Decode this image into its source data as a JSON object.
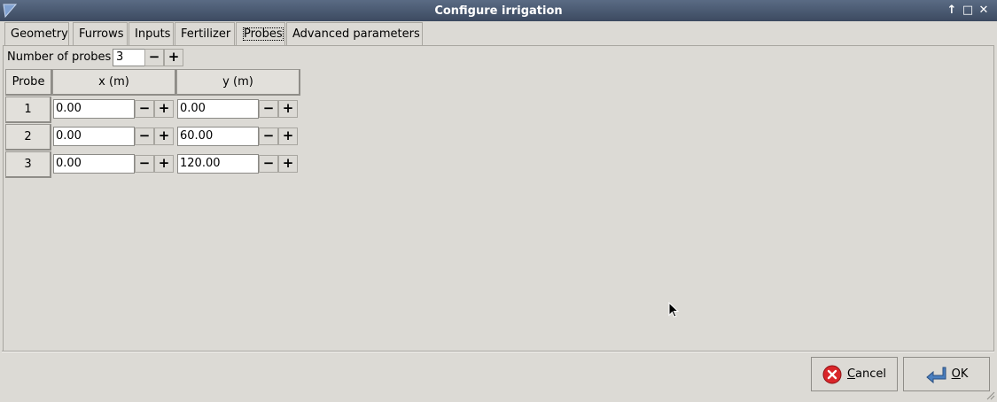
{
  "window": {
    "title": "Configure irrigation"
  },
  "tabs": [
    {
      "label": "Geometry"
    },
    {
      "label": "Furrows"
    },
    {
      "label": "Inputs"
    },
    {
      "label": "Fertilizer"
    },
    {
      "label": "Probes"
    },
    {
      "label": "Advanced parameters"
    }
  ],
  "active_tab": "Probes",
  "probes": {
    "count_label": "Number of probes",
    "count_value": "3",
    "columns": [
      "Probe",
      "x (m)",
      "y (m)"
    ],
    "rows": [
      {
        "probe": "1",
        "x": "0.00",
        "y": "0.00"
      },
      {
        "probe": "2",
        "x": "0.00",
        "y": "60.00"
      },
      {
        "probe": "3",
        "x": "0.00",
        "y": "120.00"
      }
    ]
  },
  "buttons": {
    "cancel_mnemonic": "C",
    "cancel_rest": "ancel",
    "ok_mnemonic": "O",
    "ok_rest": "K"
  },
  "spin_labels": {
    "minus": "−",
    "plus": "+"
  },
  "colors": {
    "titlebar": "#4a5a72",
    "background": "#dcdad5",
    "cancel_icon": "#d9262a",
    "ok_icon": "#4a7fc0"
  }
}
